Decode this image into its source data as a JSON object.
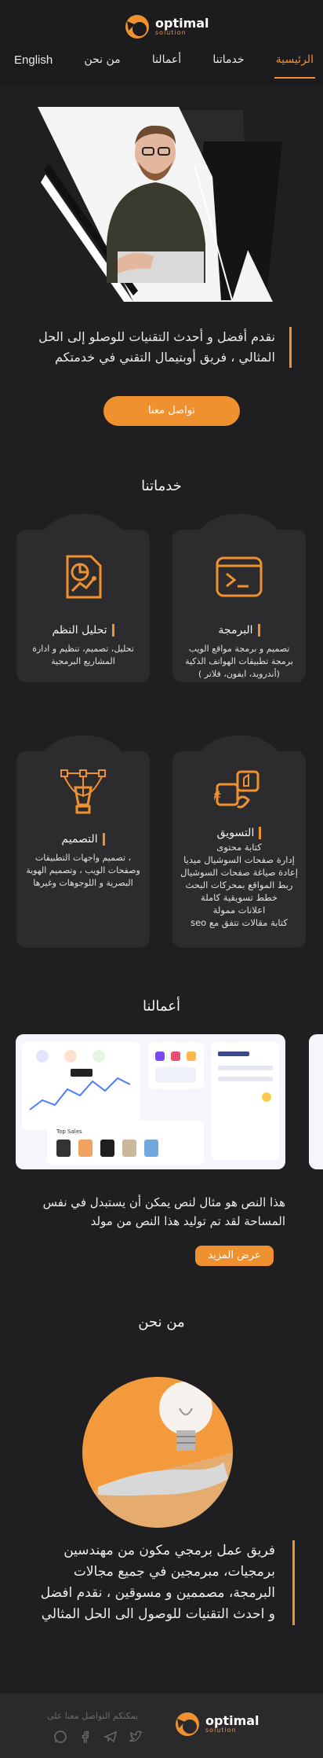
{
  "brand": {
    "name": "optimal",
    "tagline": "solution"
  },
  "nav": {
    "items": [
      {
        "label": "الرئيسية",
        "active": true
      },
      {
        "label": "خدماتنا",
        "active": false
      },
      {
        "label": "أعمالنا",
        "active": false
      },
      {
        "label": "من نحن",
        "active": false
      }
    ],
    "language": "English"
  },
  "hero": {
    "headline": "نقدم أفضل و أحدث التقنيات للوصلو إلى الحل المثالي ، فريق أوبتيمال التقني في خدمتكم",
    "cta": "تواصل معنا"
  },
  "services": {
    "title": "خدماتنا",
    "cards": [
      {
        "icon": "code-window-icon",
        "title": "البرمجة",
        "desc": [
          "تصميم و برمجة مواقع الويب",
          "برمجة تطبيقات الهواتف الذكية",
          "(أندرويد، ايفون، فلاتر )"
        ]
      },
      {
        "icon": "analytics-report-icon",
        "title": "تحليل النظم",
        "desc": [
          "تحليل، تصميم، تنظيم و ادارة",
          "المشاريع البرمجية"
        ]
      },
      {
        "icon": "social-marketing-icon",
        "title": "التسويق",
        "desc": [
          "كتابة محتوى",
          "إدارة صفحات السوشيال ميديا",
          "إعادة صياغة صفحات السوشيال",
          "ربط المواقع بمحركات البحث",
          "خطط تسويقية كاملة",
          "اعلانات ممولة",
          "كتابة مقالات تتفق مع seo"
        ]
      },
      {
        "icon": "pen-tool-design-icon",
        "title": "التصميم",
        "desc": [
          "، تصميم واجهات التطبيقات",
          "وصفحات الويب ، وتصميم الهوية",
          "البصرية و اللوجوهات وغيرها"
        ]
      }
    ]
  },
  "works": {
    "title": "أعمالنا",
    "text": "هذا النص هو مثال لنص يمكن أن يستبدل في نفس المساحة لقد تم توليد هذا النص من مولد",
    "more": "عرض المزيد",
    "preview_tag": "Top Sales"
  },
  "about": {
    "title": "من نحن",
    "text": "فريق عمل برمجي مكون من مهندسين برمجيات، مبرمجين في جميع مجالات البرمجة، مصممين و مسوقين ، نقدم افضل و احدث التقنيات للوصول الى الحل المثالي"
  },
  "footer": {
    "contact": "يمكنكم التواصل معنا على",
    "social": [
      "whatsapp-icon",
      "facebook-icon",
      "telegram-icon",
      "twitter-icon"
    ]
  },
  "colors": {
    "accent": "#f0912f",
    "background": "#1f1f21",
    "card": "#2c2c2f"
  }
}
